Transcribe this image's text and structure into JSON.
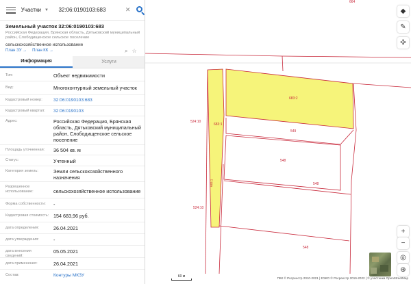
{
  "search": {
    "type_label": "Участки",
    "query": "32:06:0190103:683"
  },
  "parcel": {
    "title": "Земельный участок 32:06:0190103:683",
    "address_short": "Российская Федерация, Брянская область, Дятьковский муниципальный район, Слободищенское сельское поселение",
    "use": "сельскохозяйственное использование",
    "plan_zu": "План ЗУ →",
    "plan_kk": "План КК →"
  },
  "tabs": [
    {
      "label": "Информация"
    },
    {
      "label": "Услуги"
    }
  ],
  "info_rows": [
    {
      "label": "Тип:",
      "value": "Объект недвижимости"
    },
    {
      "label": "Вид:",
      "value": "Многоконтурный земельный участок"
    },
    {
      "label": "Кадастровый номер:",
      "value": "32:06:0190103:683"
    },
    {
      "label": "Кадастровый квартал:",
      "value": "32:06:0190103"
    },
    {
      "label": "Адрес:",
      "value": "Российская Федерация, Брянская область, Дятьковский муниципальный район, Слободищенское сельское поселение"
    },
    {
      "label": "Площадь уточненная:",
      "value": "36 504 кв. м"
    },
    {
      "label": "Статус:",
      "value": "Учтенный"
    },
    {
      "label": "Категория земель:",
      "value": "Земли сельскохозяйственного назначения"
    },
    {
      "label": "Разрешенное использование:",
      "value": "сельскохозяйственное использование"
    },
    {
      "label": "Форма собственности:",
      "value": "-"
    },
    {
      "label": "Кадастровая стоимость:",
      "value": "154 683,96 руб."
    },
    {
      "label": "дата определения:",
      "value": "26.04.2021"
    },
    {
      "label": "дата утверждения:",
      "value": "-"
    },
    {
      "label": "дата внесения сведений:",
      "value": "05.05.2021"
    },
    {
      "label": "дата применения:",
      "value": "26.04.2021"
    },
    {
      "label": "Состав:",
      "value": "Контуры МКЗУ"
    }
  ],
  "map": {
    "labels": {
      "top_right": "664",
      "main_parcel": "683:2",
      "strip_parcel": "683:1",
      "strip_parcel_lower": "683:1",
      "parcel_524_10_upper": "524:10",
      "parcel_524_10_lower": "524:10",
      "parcel_549": "549",
      "parcel_548_a": "548",
      "parcel_548_b": "548",
      "parcel_548_c": "548"
    },
    "scale_label": "60 м",
    "attribution": "ПКК © Росреестр 2010-2021 | ЕЭКО © Росреестр 2019-2022 | © участники OpenStreetMap",
    "colors": {
      "parcel_fill": "#f6f47a",
      "parcel_border": "#c8283a",
      "label": "#c8283a",
      "accent": "#2a73c9"
    }
  },
  "controls": {
    "layers_icon": "layers-icon",
    "ruler_icon": "ruler-icon",
    "locate_icon": "crosshair-icon",
    "zoom_in": "+",
    "zoom_out": "−",
    "home_icon": "target-icon",
    "plus_icon": "plus-circle-icon"
  }
}
